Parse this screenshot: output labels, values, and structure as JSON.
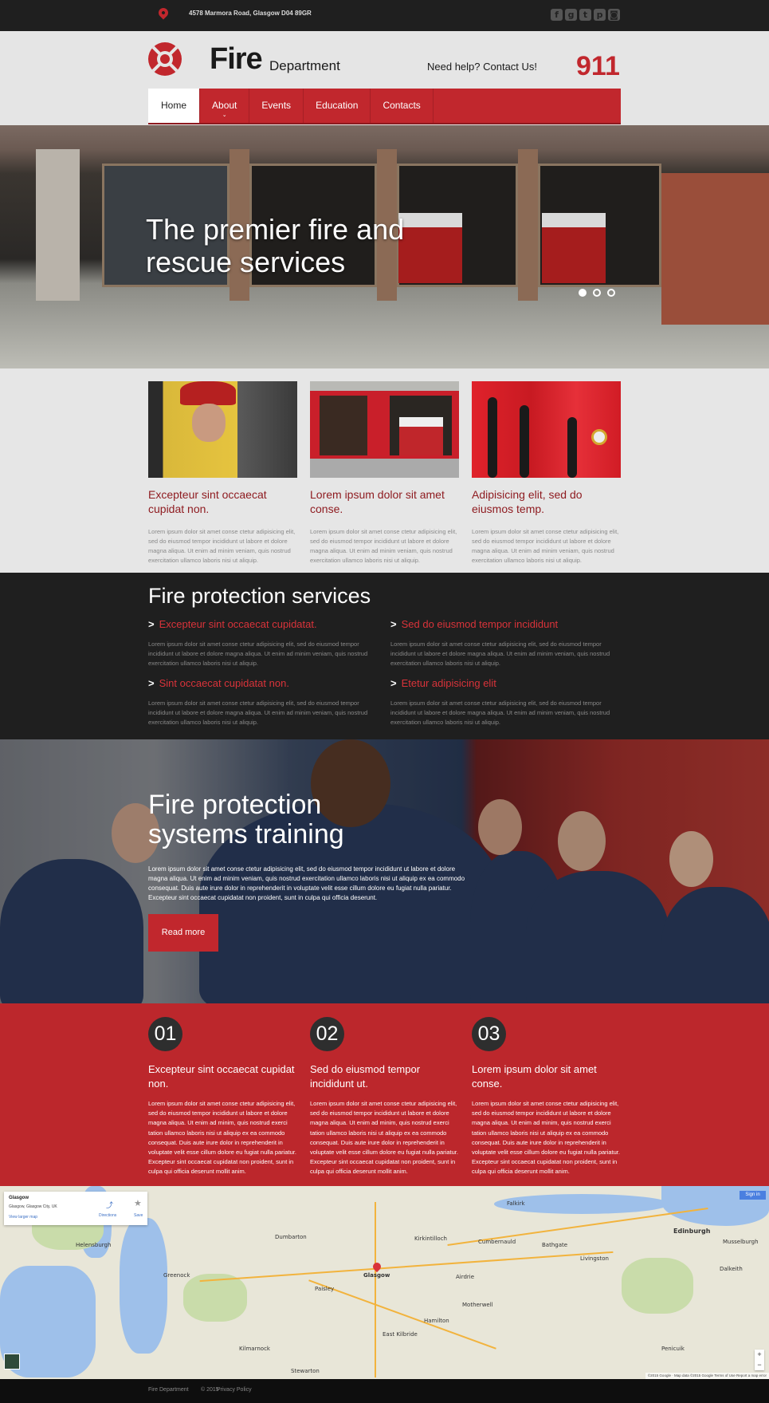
{
  "topbar": {
    "address": "4578 Marmora Road, Glasgow D04 89GR",
    "social": [
      {
        "icon": "facebook-icon",
        "glyph": "f"
      },
      {
        "icon": "google-plus-icon",
        "glyph": "g"
      },
      {
        "icon": "tumblr-icon",
        "glyph": "t"
      },
      {
        "icon": "pinterest-icon",
        "glyph": "p"
      },
      {
        "icon": "instagram-icon",
        "glyph": "◙"
      }
    ]
  },
  "header": {
    "brand_main": "Fire",
    "brand_sub": "Department",
    "help_text": "Need help? Contact Us!",
    "phone": "911"
  },
  "nav": {
    "items": [
      {
        "label": "Home",
        "active": true
      },
      {
        "label": "About",
        "has_dropdown": true
      },
      {
        "label": "Events"
      },
      {
        "label": "Education"
      },
      {
        "label": "Contacts"
      }
    ],
    "dropdown_glyph": "⌄"
  },
  "hero": {
    "title_line1": "The premier fire and",
    "title_line2": "rescue services",
    "slides": 3,
    "active_slide": 1
  },
  "features": [
    {
      "title": "Excepteur sint occaecat cupidat non.",
      "text": "Lorem ipsum dolor sit amet conse ctetur adipisicing elit, sed do eiusmod tempor incididunt ut labore et dolore magna aliqua. Ut enim ad minim veniam, quis nostrud exercitation ullamco laboris nisi ut aliquip."
    },
    {
      "title": "Lorem ipsum dolor sit amet conse.",
      "text": "Lorem ipsum dolor sit amet conse ctetur adipisicing elit, sed do eiusmod tempor incididunt ut labore et dolore magna aliqua. Ut enim ad minim veniam, quis nostrud exercitation ullamco laboris nisi ut aliquip."
    },
    {
      "title": "Adipisicing elit, sed do eiusmos temp.",
      "text": "Lorem ipsum dolor sit amet conse ctetur adipisicing elit, sed do eiusmod tempor incididunt ut labore et dolore magna aliqua. Ut enim ad minim veniam, quis nostrud exercitation ullamco laboris nisi ut aliquip."
    }
  ],
  "services": {
    "heading": "Fire protection services",
    "arrow": ">",
    "items": [
      {
        "title": "Excepteur sint occaecat cupidatat.",
        "text": "Lorem ipsum dolor sit amet conse ctetur adipisicing elit, sed do eiusmod tempor incididunt ut labore et dolore magna aliqua. Ut enim ad minim veniam, quis nostrud exercitation ullamco laboris nisi ut aliquip."
      },
      {
        "title": "Sed do eiusmod tempor incididunt",
        "text": "Lorem ipsum dolor sit amet conse ctetur adipisicing elit, sed do eiusmod tempor incididunt ut labore et dolore magna aliqua. Ut enim ad minim veniam, quis nostrud exercitation ullamco laboris nisi ut aliquip."
      },
      {
        "title": "Sint occaecat cupidatat non.",
        "text": "Lorem ipsum dolor sit amet conse ctetur adipisicing elit, sed do eiusmod tempor incididunt ut labore et dolore magna aliqua. Ut enim ad minim veniam, quis nostrud exercitation ullamco laboris nisi ut aliquip."
      },
      {
        "title": "Etetur adipisicing elit",
        "text": "Lorem ipsum dolor sit amet conse ctetur adipisicing elit, sed do eiusmod tempor incididunt ut labore et dolore magna aliqua. Ut enim ad minim veniam, quis nostrud exercitation ullamco laboris nisi ut aliquip."
      }
    ]
  },
  "training": {
    "title_line1": "Fire protection",
    "title_line2": "systems training",
    "text": "Lorem ipsum dolor sit amet conse ctetur adipisicing elit, sed do eiusmod tempor incididunt ut labore et dolore magna aliqua. Ut enim ad minim veniam, quis nostrud exercitation ullamco laboris nisi ut aliquip ex ea commodo consequat. Duis aute irure dolor in reprehenderit in voluptate velit esse cillum dolore eu fugiat nulla pariatur. Excepteur sint occaecat cupidatat non proident, sunt in culpa qui officia deserunt.",
    "button": "Read more"
  },
  "steps": [
    {
      "num": "01",
      "title": "Excepteur sint occaecat cupidat non.",
      "text": "Lorem ipsum dolor sit amet conse ctetur adipisicing elit, sed do eiusmod tempor incididunt ut labore et dolore magna aliqua. Ut enim ad minim, quis nostrud exerci tation ullamco laboris nisi ut aliquip ex ea commodo consequat. Duis aute irure dolor in reprehenderit in voluptate velit esse cillum dolore eu fugiat nulla pariatur. Excepteur sint occaecat cupidatat non proident, sunt in culpa qui officia deserunt mollit anim."
    },
    {
      "num": "02",
      "title": "Sed do eiusmod tempor incididunt ut.",
      "text": "Lorem ipsum dolor sit amet conse ctetur adipisicing elit, sed do eiusmod tempor incididunt ut labore et dolore magna aliqua. Ut enim ad minim, quis nostrud exerci tation ullamco laboris nisi ut aliquip ex ea commodo consequat. Duis aute irure dolor in reprehenderit in voluptate velit esse cillum dolore eu fugiat nulla pariatur. Excepteur sint occaecat cupidatat non proident, sunt in culpa qui officia deserunt mollit anim."
    },
    {
      "num": "03",
      "title": "Lorem ipsum dolor sit amet conse.",
      "text": "Lorem ipsum dolor sit amet conse ctetur adipisicing elit, sed do eiusmod tempor incididunt ut labore et dolore magna aliqua. Ut enim ad minim, quis nostrud exerci tation ullamco laboris nisi ut aliquip ex ea commodo consequat. Duis aute irure dolor in reprehenderit in voluptate velit esse cillum dolore eu fugiat nulla pariatur. Excepteur sint occaecat cupidatat non proident, sunt in culpa qui officia deserunt mollit anim."
    }
  ],
  "map": {
    "card_title": "Glasgow",
    "card_subtitle": "Glasgow, Glasgow City, UK",
    "card_link": "View larger map",
    "directions": "Directions",
    "save": "Save",
    "sign_in": "Sign in",
    "zoom_in": "+",
    "zoom_out": "−",
    "attribution": "©2015 Google · Map data ©2015 Google   Terms of Use   Report a map error",
    "labels": [
      "Glasgow",
      "Edinburgh",
      "Paisley",
      "Falkirk",
      "Livingston",
      "Hamilton",
      "East Kilbride",
      "Musselburgh",
      "Dalkeith",
      "Kilmarnock",
      "Stewarton",
      "Dumbarton",
      "Helensburgh",
      "Kirkintilloch",
      "Cumbernauld",
      "Airdrie",
      "Motherwell",
      "Greenock",
      "Penicuik",
      "Bathgate"
    ]
  },
  "footer": {
    "name": "Fire Department",
    "copyright": "© 2015",
    "privacy": "Privacy Policy"
  }
}
